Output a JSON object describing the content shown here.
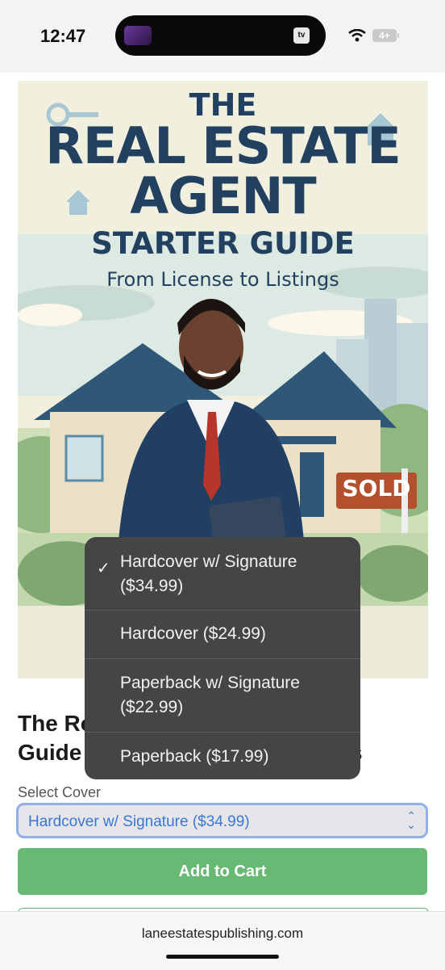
{
  "status_bar": {
    "time": "12:47",
    "battery": "4+"
  },
  "book": {
    "cover_line1": "THE",
    "cover_line2": "REAL ESTATE",
    "cover_line3": "AGENT",
    "cover_line4": "STARTER GUIDE",
    "cover_subtitle": "From License to Listings",
    "sold_sign": "SOLD",
    "title_visible_line1": "The Ro",
    "title_visible_line2": "Guide",
    "title_visible_tail": "s"
  },
  "cover_select": {
    "label": "Select Cover",
    "value": "Hardcover w/ Signature ($34.99)",
    "options": [
      {
        "line1": "Hardcover w/ Signature",
        "line2": "($34.99)",
        "selected": true
      },
      {
        "line1": "Hardcover ($24.99)",
        "line2": "",
        "selected": false
      },
      {
        "line1": "Paperback w/ Signature",
        "line2": "($22.99)",
        "selected": false
      },
      {
        "line1": "Paperback ($17.99)",
        "line2": "",
        "selected": false
      }
    ]
  },
  "actions": {
    "add_to_cart": "Add to Cart"
  },
  "browser": {
    "url": "laneestatespublishing.com"
  },
  "colors": {
    "accent_green": "#67b974",
    "select_blue": "#3a78d6",
    "menu_bg": "#454545",
    "cover_navy": "#22405f"
  }
}
